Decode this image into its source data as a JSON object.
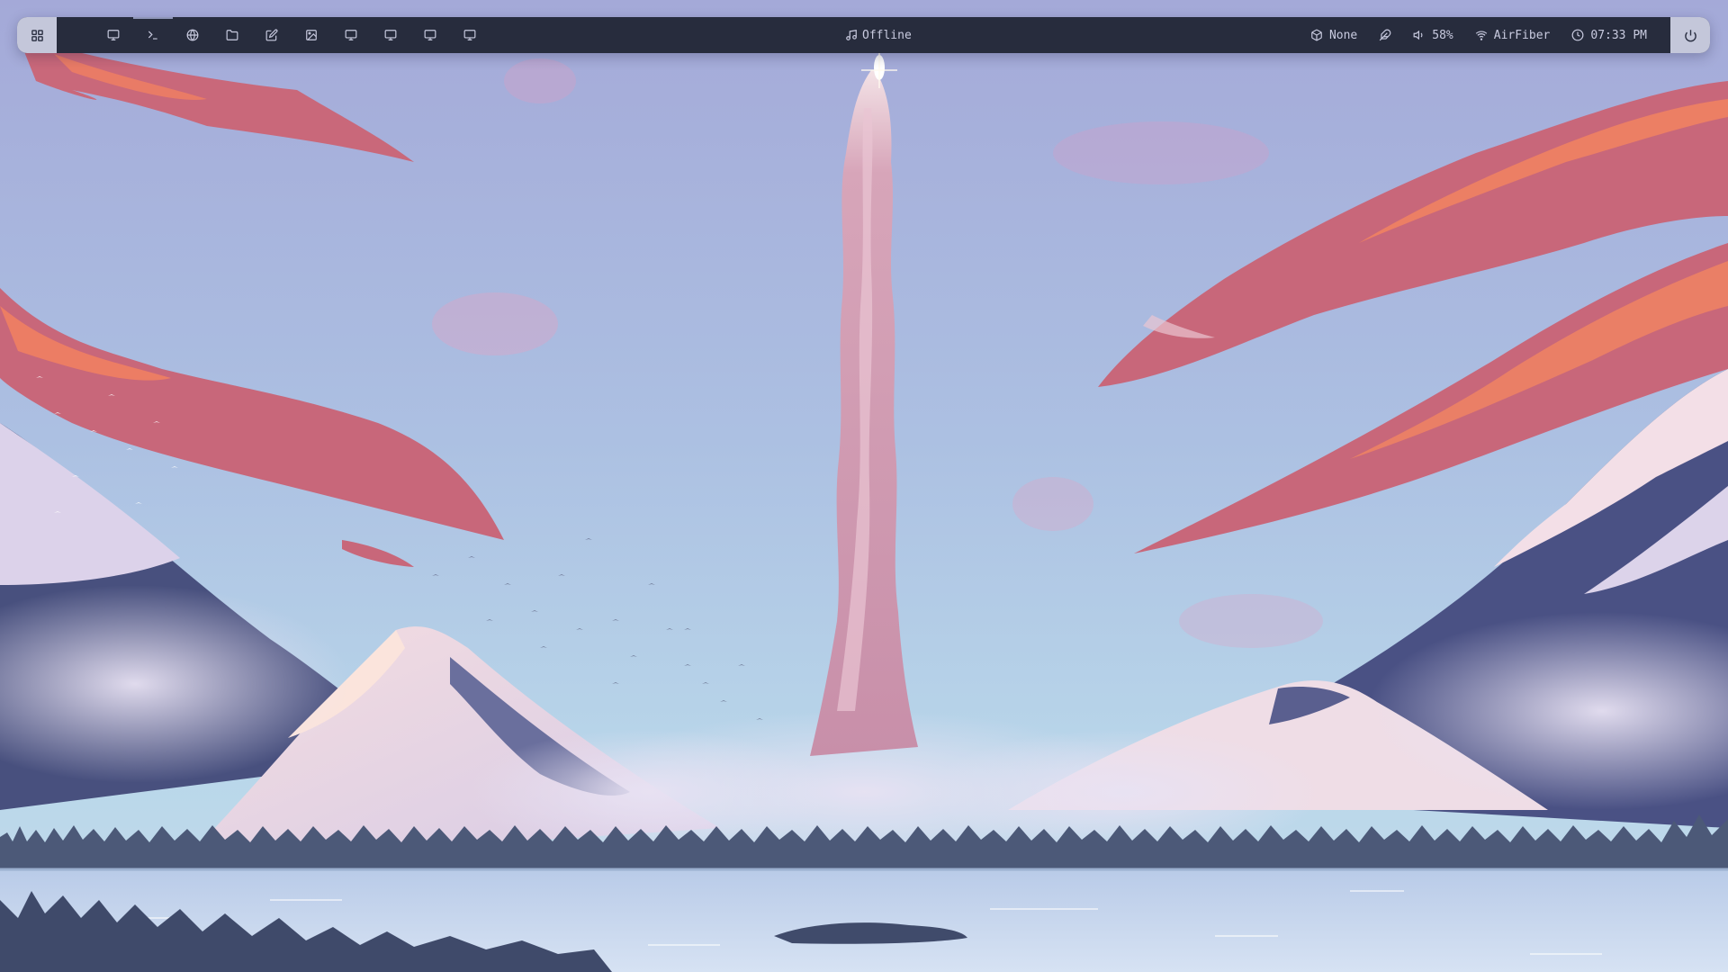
{
  "colors": {
    "bar_bg": "#272c3d",
    "bar_text": "#c9cbe0",
    "bar_cap": "#c4c7da",
    "sky_top": "#a8aedb",
    "sky_bottom": "#b7d3e8",
    "cloud": "#cc6b79",
    "cloud_highlight": "#f08462",
    "water": "#c5d6ee"
  },
  "launcher": {
    "icon": "grid-icon"
  },
  "dock": [
    {
      "icon": "monitor-icon",
      "active": false
    },
    {
      "icon": "terminal-icon",
      "active": true
    },
    {
      "icon": "globe-icon",
      "active": false
    },
    {
      "icon": "folder-icon",
      "active": false
    },
    {
      "icon": "edit-icon",
      "active": false
    },
    {
      "icon": "image-icon",
      "active": false
    },
    {
      "icon": "monitor-icon",
      "active": false
    },
    {
      "icon": "monitor-icon",
      "active": false
    },
    {
      "icon": "monitor-icon",
      "active": false
    },
    {
      "icon": "monitor-icon",
      "active": false
    }
  ],
  "media": {
    "icon": "music-icon",
    "label": "Offline"
  },
  "status": {
    "package": {
      "icon": "package-icon",
      "label": "None"
    },
    "feather": {
      "icon": "feather-icon"
    },
    "volume": {
      "icon": "volume-icon",
      "label": "58%"
    },
    "network": {
      "icon": "wifi-icon",
      "label": "AirFiber"
    },
    "clock": {
      "icon": "clock-icon",
      "label": "07:33 PM"
    }
  },
  "power": {
    "icon": "power-icon"
  }
}
